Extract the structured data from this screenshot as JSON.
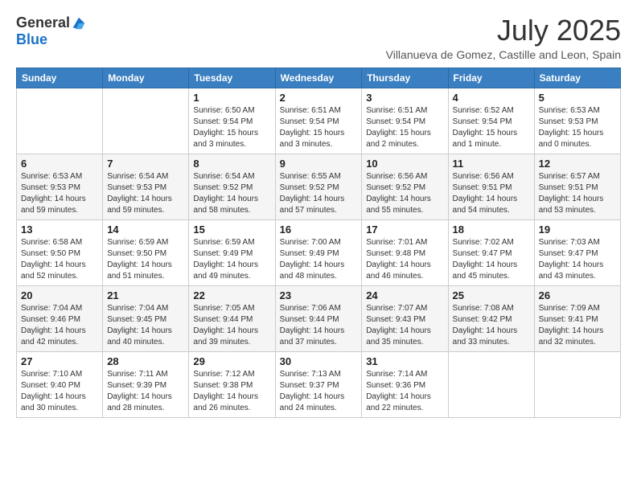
{
  "logo": {
    "general": "General",
    "blue": "Blue"
  },
  "title": "July 2025",
  "subtitle": "Villanueva de Gomez, Castille and Leon, Spain",
  "days_of_week": [
    "Sunday",
    "Monday",
    "Tuesday",
    "Wednesday",
    "Thursday",
    "Friday",
    "Saturday"
  ],
  "weeks": [
    [
      {
        "day": null,
        "info": null
      },
      {
        "day": null,
        "info": null
      },
      {
        "day": "1",
        "info": "Sunrise: 6:50 AM\nSunset: 9:54 PM\nDaylight: 15 hours and 3 minutes."
      },
      {
        "day": "2",
        "info": "Sunrise: 6:51 AM\nSunset: 9:54 PM\nDaylight: 15 hours and 3 minutes."
      },
      {
        "day": "3",
        "info": "Sunrise: 6:51 AM\nSunset: 9:54 PM\nDaylight: 15 hours and 2 minutes."
      },
      {
        "day": "4",
        "info": "Sunrise: 6:52 AM\nSunset: 9:54 PM\nDaylight: 15 hours and 1 minute."
      },
      {
        "day": "5",
        "info": "Sunrise: 6:53 AM\nSunset: 9:53 PM\nDaylight: 15 hours and 0 minutes."
      }
    ],
    [
      {
        "day": "6",
        "info": "Sunrise: 6:53 AM\nSunset: 9:53 PM\nDaylight: 14 hours and 59 minutes."
      },
      {
        "day": "7",
        "info": "Sunrise: 6:54 AM\nSunset: 9:53 PM\nDaylight: 14 hours and 59 minutes."
      },
      {
        "day": "8",
        "info": "Sunrise: 6:54 AM\nSunset: 9:52 PM\nDaylight: 14 hours and 58 minutes."
      },
      {
        "day": "9",
        "info": "Sunrise: 6:55 AM\nSunset: 9:52 PM\nDaylight: 14 hours and 57 minutes."
      },
      {
        "day": "10",
        "info": "Sunrise: 6:56 AM\nSunset: 9:52 PM\nDaylight: 14 hours and 55 minutes."
      },
      {
        "day": "11",
        "info": "Sunrise: 6:56 AM\nSunset: 9:51 PM\nDaylight: 14 hours and 54 minutes."
      },
      {
        "day": "12",
        "info": "Sunrise: 6:57 AM\nSunset: 9:51 PM\nDaylight: 14 hours and 53 minutes."
      }
    ],
    [
      {
        "day": "13",
        "info": "Sunrise: 6:58 AM\nSunset: 9:50 PM\nDaylight: 14 hours and 52 minutes."
      },
      {
        "day": "14",
        "info": "Sunrise: 6:59 AM\nSunset: 9:50 PM\nDaylight: 14 hours and 51 minutes."
      },
      {
        "day": "15",
        "info": "Sunrise: 6:59 AM\nSunset: 9:49 PM\nDaylight: 14 hours and 49 minutes."
      },
      {
        "day": "16",
        "info": "Sunrise: 7:00 AM\nSunset: 9:49 PM\nDaylight: 14 hours and 48 minutes."
      },
      {
        "day": "17",
        "info": "Sunrise: 7:01 AM\nSunset: 9:48 PM\nDaylight: 14 hours and 46 minutes."
      },
      {
        "day": "18",
        "info": "Sunrise: 7:02 AM\nSunset: 9:47 PM\nDaylight: 14 hours and 45 minutes."
      },
      {
        "day": "19",
        "info": "Sunrise: 7:03 AM\nSunset: 9:47 PM\nDaylight: 14 hours and 43 minutes."
      }
    ],
    [
      {
        "day": "20",
        "info": "Sunrise: 7:04 AM\nSunset: 9:46 PM\nDaylight: 14 hours and 42 minutes."
      },
      {
        "day": "21",
        "info": "Sunrise: 7:04 AM\nSunset: 9:45 PM\nDaylight: 14 hours and 40 minutes."
      },
      {
        "day": "22",
        "info": "Sunrise: 7:05 AM\nSunset: 9:44 PM\nDaylight: 14 hours and 39 minutes."
      },
      {
        "day": "23",
        "info": "Sunrise: 7:06 AM\nSunset: 9:44 PM\nDaylight: 14 hours and 37 minutes."
      },
      {
        "day": "24",
        "info": "Sunrise: 7:07 AM\nSunset: 9:43 PM\nDaylight: 14 hours and 35 minutes."
      },
      {
        "day": "25",
        "info": "Sunrise: 7:08 AM\nSunset: 9:42 PM\nDaylight: 14 hours and 33 minutes."
      },
      {
        "day": "26",
        "info": "Sunrise: 7:09 AM\nSunset: 9:41 PM\nDaylight: 14 hours and 32 minutes."
      }
    ],
    [
      {
        "day": "27",
        "info": "Sunrise: 7:10 AM\nSunset: 9:40 PM\nDaylight: 14 hours and 30 minutes."
      },
      {
        "day": "28",
        "info": "Sunrise: 7:11 AM\nSunset: 9:39 PM\nDaylight: 14 hours and 28 minutes."
      },
      {
        "day": "29",
        "info": "Sunrise: 7:12 AM\nSunset: 9:38 PM\nDaylight: 14 hours and 26 minutes."
      },
      {
        "day": "30",
        "info": "Sunrise: 7:13 AM\nSunset: 9:37 PM\nDaylight: 14 hours and 24 minutes."
      },
      {
        "day": "31",
        "info": "Sunrise: 7:14 AM\nSunset: 9:36 PM\nDaylight: 14 hours and 22 minutes."
      },
      {
        "day": null,
        "info": null
      },
      {
        "day": null,
        "info": null
      }
    ]
  ]
}
